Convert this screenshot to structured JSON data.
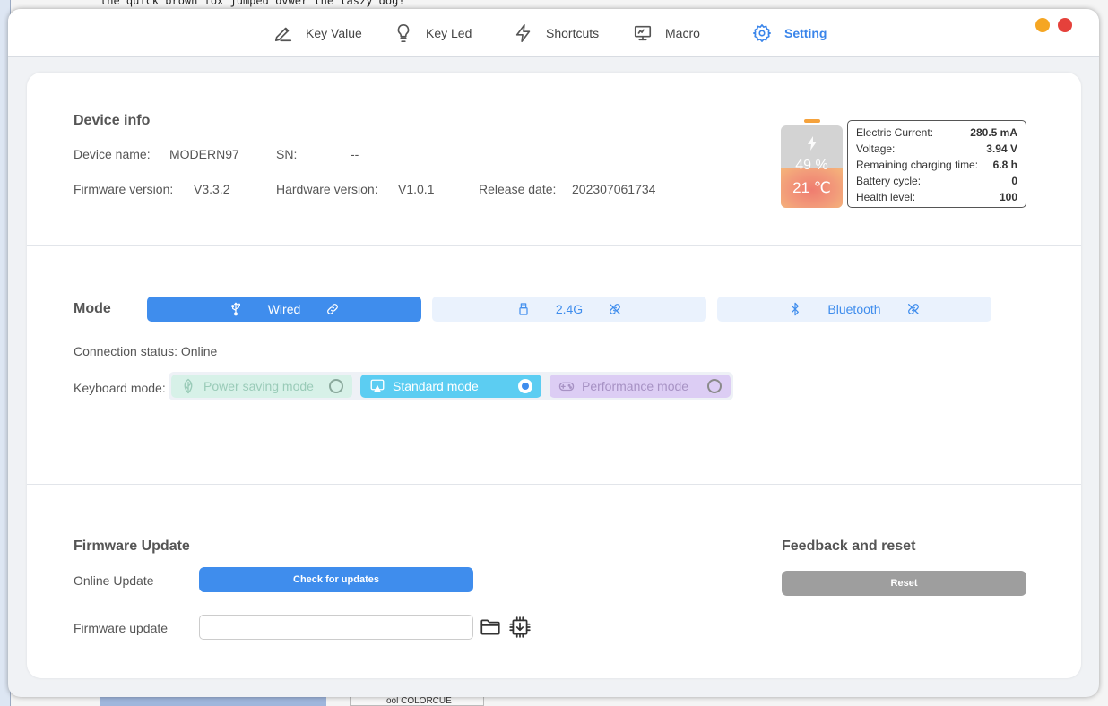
{
  "background": {
    "desktop_text": "the quick brown fox jumped ovwer the laszy dog!",
    "taskbar_label": "ool COLORCUE"
  },
  "window_controls": {
    "minimize_color": "#f5a623",
    "close_color": "#e5413b"
  },
  "nav": {
    "items": [
      {
        "label": "Key Value",
        "icon": "pen-tool-icon"
      },
      {
        "label": "Key Led",
        "icon": "lightbulb-icon"
      },
      {
        "label": "Shortcuts",
        "icon": "lightning-icon"
      },
      {
        "label": "Macro",
        "icon": "monitor-icon"
      },
      {
        "label": "Setting",
        "icon": "gear-icon",
        "active": true
      }
    ]
  },
  "device_info": {
    "title": "Device info",
    "device_name_label": "Device name:",
    "device_name": "MODERN97",
    "sn_label": "SN:",
    "sn": "--",
    "firmware_label": "Firmware version:",
    "firmware": "V3.3.2",
    "hardware_label": "Hardware version:",
    "hardware": "V1.0.1",
    "release_label": "Release date:",
    "release": "202307061734"
  },
  "battery": {
    "percent_text": "49 %",
    "level": 0.49,
    "temperature": "21 ℃",
    "stats": [
      {
        "label": "Electric Current:",
        "value": "280.5 mA"
      },
      {
        "label": "Voltage:",
        "value": "3.94 V"
      },
      {
        "label": "Remaining charging time:",
        "value": "6.8 h"
      },
      {
        "label": "Battery cycle:",
        "value": "0"
      },
      {
        "label": "Health level:",
        "value": "100"
      }
    ]
  },
  "mode": {
    "title": "Mode",
    "options": [
      {
        "label": "Wired",
        "icon": "usb-icon",
        "active": true
      },
      {
        "label": "2.4G",
        "icon": "dongle-icon",
        "active": false
      },
      {
        "label": "Bluetooth",
        "icon": "bluetooth-icon",
        "active": false
      }
    ],
    "connection_status": "Connection status: Online",
    "keyboard_mode_label": "Keyboard mode:",
    "keyboard_modes": [
      {
        "label": "Power saving mode",
        "selected": false,
        "color": "#d7f1e8",
        "text_color": "#9acbb8"
      },
      {
        "label": "Standard mode",
        "selected": true,
        "color": "#5ccdf2",
        "text_color": "#ffffff"
      },
      {
        "label": "Performance mode",
        "selected": false,
        "color": "#dccdf4",
        "text_color": "#a792c4"
      }
    ]
  },
  "firmware_update": {
    "title": "Firmware Update",
    "online_label": "Online Update",
    "check_button": "Check for updates",
    "file_label": "Firmware update",
    "file_value": ""
  },
  "feedback": {
    "title": "Feedback and reset",
    "reset_button": "Reset"
  }
}
